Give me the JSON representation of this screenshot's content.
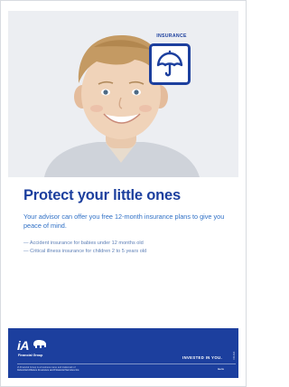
{
  "badge": {
    "label": "INSURANCE",
    "icon": "umbrella-icon",
    "color": "#1c3f9e"
  },
  "headline": "Protect your little ones",
  "subtitle": "Your advisor can offer you free 12-month insurance plans to give you peace of mind.",
  "bullets": [
    "— Accident insurance for babies under 12 months old",
    "— Critical illness insurance for children 2 to 5 years old"
  ],
  "footer": {
    "logo_main": "iA",
    "logo_sub": "Financial Group",
    "tagline": "INVESTED IN YOU.",
    "legal_line1": "iA Financial Group is a business name and trademark of",
    "legal_line2": "Industrial Alliance Insurance and Financial Services Inc.",
    "website": "ia.ca",
    "code": "F00-00A"
  },
  "colors": {
    "brand_blue": "#1c3f9e",
    "light_blue": "#2f70c6",
    "panel": "#eceef2"
  }
}
